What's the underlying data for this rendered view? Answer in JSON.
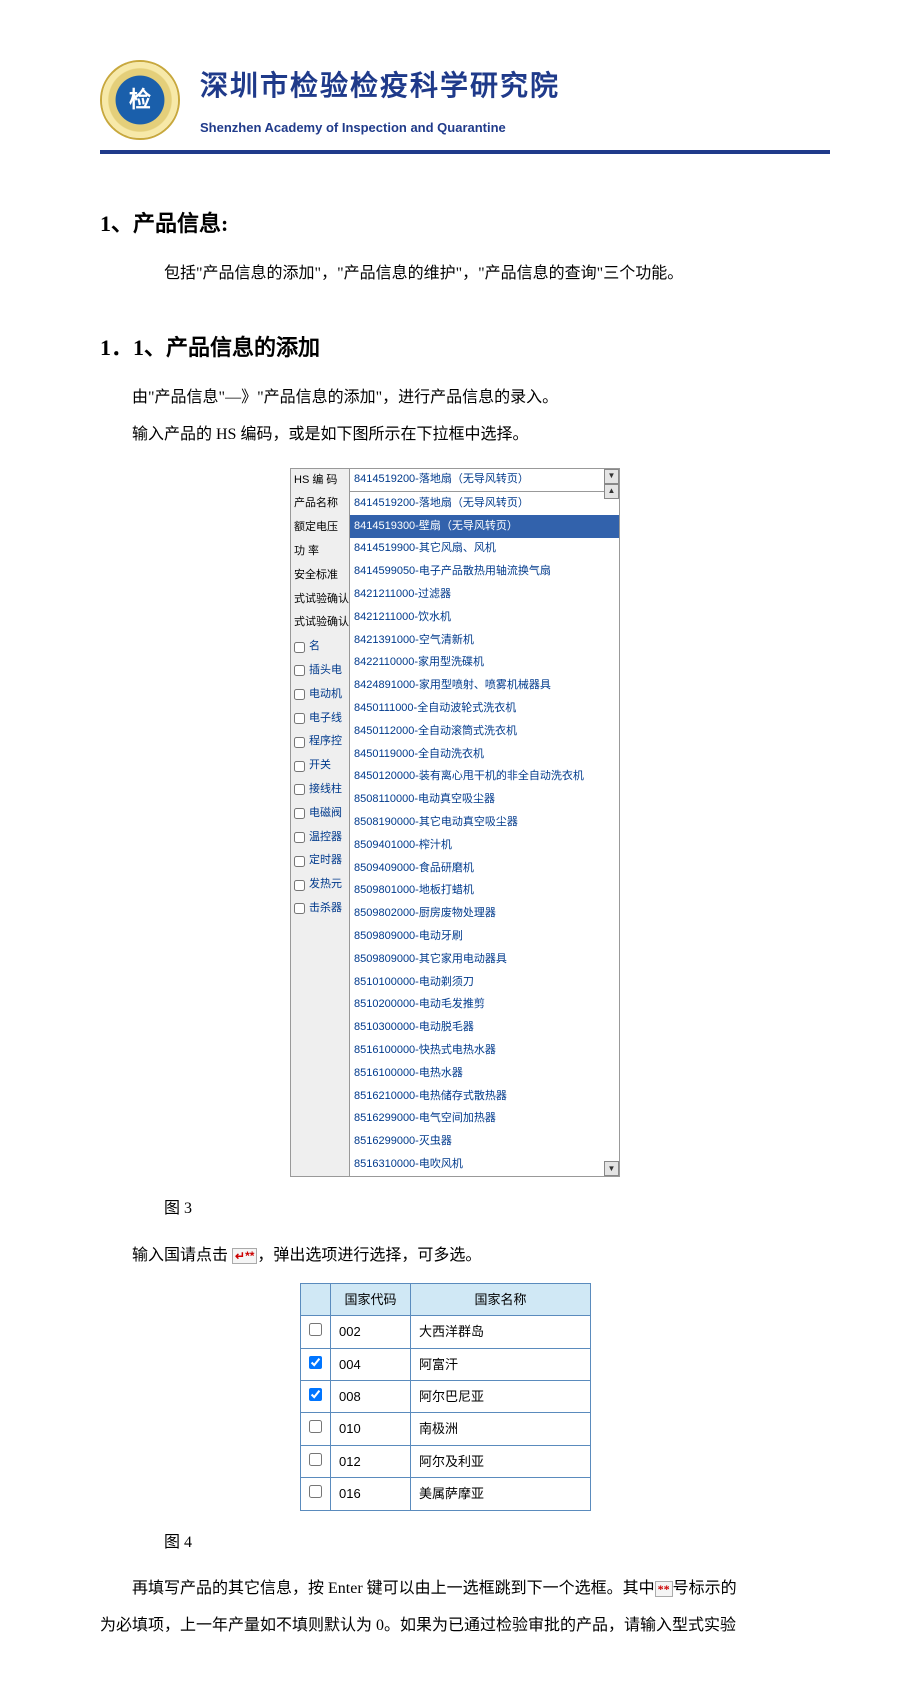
{
  "header": {
    "org_cn": "深圳市检验检疫科学研究院",
    "org_en": "Shenzhen Academy of Inspection and Quarantine"
  },
  "section1": {
    "heading": "1、产品信息:",
    "intro": "包括\"产品信息的添加\"，\"产品信息的维护\"，\"产品信息的查询\"三个功能。"
  },
  "section11": {
    "heading": "1．1、产品信息的添加",
    "p1": "由\"产品信息\"—》\"产品信息的添加\"，进行产品信息的录入。",
    "p2": "输入产品的 HS 编码，或是如下图所示在下拉框中选择。"
  },
  "fig3": {
    "labels": [
      "HS 编 码",
      "产品名称",
      "额定电压",
      "功    率",
      "安全标准",
      "式试验确认书编号",
      "式试验确认发证日期"
    ],
    "header_value": "8414519200-落地扇（无导风转页）",
    "left_items": [
      "名",
      "插头电",
      "电动机",
      "电子线",
      "程序控",
      "开关",
      "接线柱",
      "电磁阀",
      "温控器",
      "定时器",
      "发热元",
      "击杀器"
    ],
    "options": [
      "8414519200-落地扇（无导风转页）",
      "8414519300-壁扇（无导风转页）",
      "8414519900-其它风扇、风机",
      "8414599050-电子产品散热用轴流换气扇",
      "8421211000-过滤器",
      "8421211000-饮水机",
      "8421391000-空气清新机",
      "8422110000-家用型洗碟机",
      "8424891000-家用型喷射、喷雾机械器具",
      "8450111000-全自动波轮式洗衣机",
      "8450112000-全自动滚筒式洗衣机",
      "8450119000-全自动洗衣机",
      "8450120000-装有离心甩干机的非全自动洗衣机",
      "8508110000-电动真空吸尘器",
      "8508190000-其它电动真空吸尘器",
      "8509401000-榨汁机",
      "8509409000-食品研磨机",
      "8509801000-地板打蜡机",
      "8509802000-厨房废物处理器",
      "8509809000-电动牙刷",
      "8509809000-其它家用电动器具",
      "8510100000-电动剃须刀",
      "8510200000-电动毛发推剪",
      "8510300000-电动脱毛器",
      "8516100000-快热式电热水器",
      "8516100000-电热水器",
      "8516210000-电热储存式散热器",
      "8516299000-电气空间加热器",
      "8516299000-灭虫器",
      "8516310000-电吹风机"
    ],
    "selected_index": 1,
    "caption": "图 3"
  },
  "mid_text": {
    "t1": "输入国请点击 ",
    "icon": "↵**",
    "t2": "，弹出选项进行选择，可多选。"
  },
  "fig4": {
    "headers": {
      "blank": "",
      "code": "国家代码",
      "name": "国家名称"
    },
    "rows": [
      {
        "checked": false,
        "code": "002",
        "name": "大西洋群岛"
      },
      {
        "checked": true,
        "code": "004",
        "name": "阿富汗"
      },
      {
        "checked": true,
        "code": "008",
        "name": "阿尔巴尼亚"
      },
      {
        "checked": false,
        "code": "010",
        "name": "南极洲"
      },
      {
        "checked": false,
        "code": "012",
        "name": "阿尔及利亚"
      },
      {
        "checked": false,
        "code": "016",
        "name": "美属萨摩亚"
      }
    ],
    "caption": "图 4"
  },
  "tail": {
    "p1a": "再填写产品的其它信息，按 Enter 键可以由上一选框跳到下一个选框。其中",
    "star": "**",
    "p1b": "号标示的",
    "p2": "为必填项，上一年产量如不填则默认为 0。如果为已通过检验审批的产品，请输入型式实验"
  }
}
